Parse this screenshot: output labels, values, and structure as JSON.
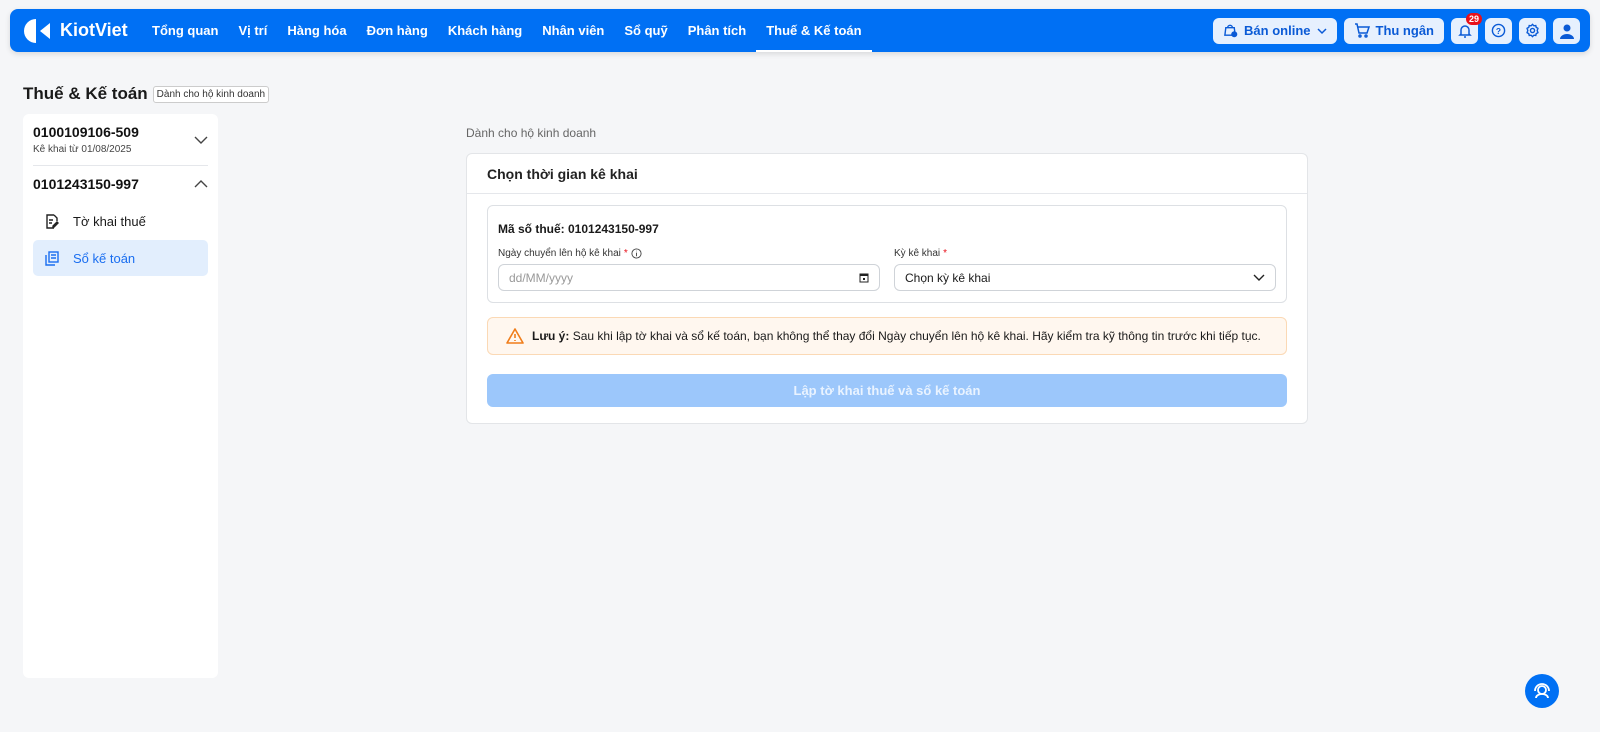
{
  "header": {
    "brand": "KiotViet",
    "nav": [
      "Tổng quan",
      "Vị trí",
      "Hàng hóa",
      "Đơn hàng",
      "Khách hàng",
      "Nhân viên",
      "Sổ quỹ",
      "Phân tích",
      "Thuế & Kế toán"
    ],
    "active_nav": "Thuế & Kế toán",
    "online_label": "Bán online",
    "cashier_label": "Thu ngân",
    "notification_count": "29"
  },
  "page": {
    "title": "Thuế & Kế toán",
    "tag": "Dành cho hộ kinh doanh"
  },
  "sidebar": {
    "accounts": [
      {
        "id": "0100109106-509",
        "sub": "Kê khai từ 01/08/2025",
        "expanded": false
      },
      {
        "id": "0101243150-997",
        "expanded": true
      }
    ],
    "items": [
      {
        "label": "Tờ khai thuế",
        "active": false
      },
      {
        "label": "Sổ kế toán",
        "active": true
      }
    ]
  },
  "main": {
    "breadcrumb": "Dành cho hộ kinh doanh",
    "card_title": "Chọn thời gian kê khai",
    "tax_code_label": "Mã số thuế: 0101243150-997",
    "date_label": "Ngày chuyển lên hộ kê khai",
    "date_placeholder": "dd/MM/yyyy",
    "period_label": "Kỳ kê khai",
    "period_value": "Chọn kỳ kê khai",
    "required_mark": "*",
    "warning_title": "Lưu ý:",
    "warning_text": "Sau khi lập tờ khai và sổ kế toán, bạn không thể thay đổi Ngày chuyển lên hộ kê khai. Hãy kiểm tra kỹ thông tin trước khi tiếp tục.",
    "submit_label": "Lập tờ khai thuế và sổ kế toán"
  }
}
